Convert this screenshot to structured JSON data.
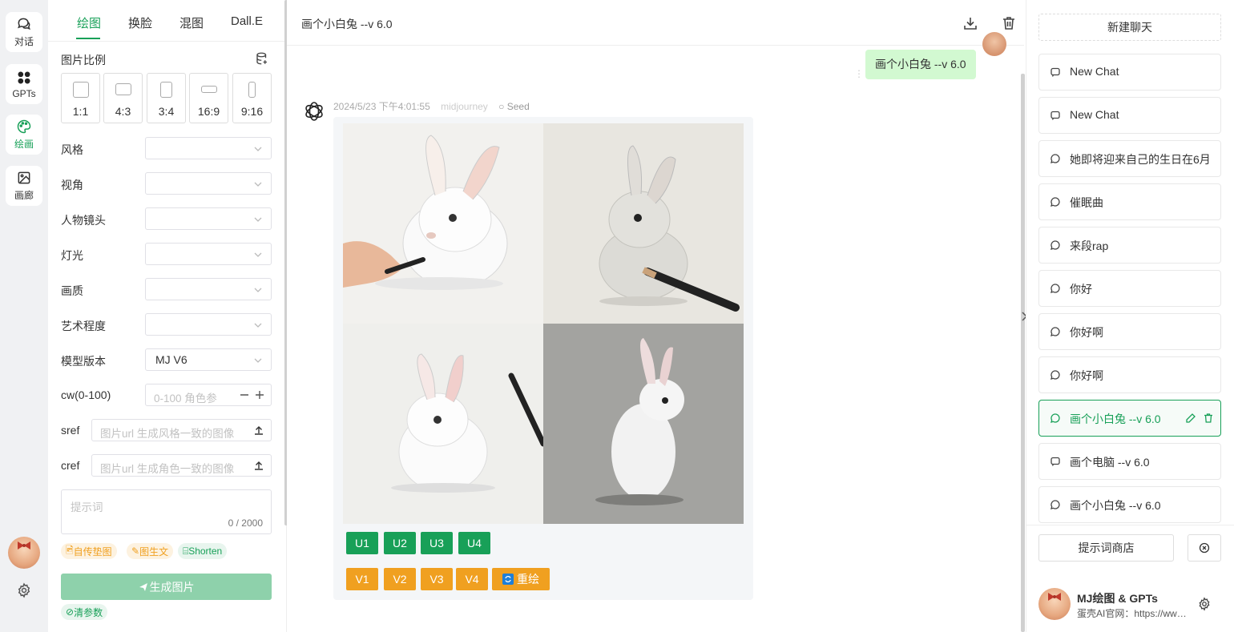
{
  "rail": {
    "items": [
      {
        "label": "对话",
        "icon": "chat-bubbles-icon"
      },
      {
        "label": "GPTs",
        "icon": "apps-grid-icon"
      },
      {
        "label": "绘画",
        "icon": "palette-icon"
      },
      {
        "label": "画廊",
        "icon": "gallery-image-icon"
      }
    ]
  },
  "settings": {
    "tabs": [
      "绘图",
      "换脸",
      "混图",
      "Dall.E"
    ],
    "active_tab": "绘图",
    "ratio_title": "图片比例",
    "ratios": [
      "1:1",
      "4:3",
      "3:4",
      "16:9",
      "9:16"
    ],
    "fields": {
      "style": "风格",
      "angle": "视角",
      "shot": "人物镜头",
      "light": "灯光",
      "quality": "画质",
      "art": "艺术程度",
      "model": "模型版本",
      "model_value": "MJ V6",
      "cw": "cw(0-100)",
      "cw_placeholder": "0-100 角色参",
      "sref": "sref",
      "sref_placeholder": "图片url 生成风格一致的图像",
      "cref": "cref",
      "cref_placeholder": "图片url 生成角色一致的图像"
    },
    "prompt_placeholder": "提示词",
    "prompt_count": "0 / 2000",
    "tags": {
      "upload": "自传垫图",
      "img2txt": "图生文",
      "shorten": "Shorten"
    },
    "generate_label": "生成图片",
    "clear_params": "清参数"
  },
  "chat": {
    "title": "画个小白兔 --v 6.0",
    "user_message": "画个小白兔 --v 6.0",
    "meta": {
      "time": "2024/5/23 下午4:01:55",
      "model": "midjourney",
      "seed": "Seed"
    },
    "u_buttons": [
      "U1",
      "U2",
      "U3",
      "U4"
    ],
    "v_buttons": [
      "V1",
      "V2",
      "V3",
      "V4"
    ],
    "redraw_label": "重绘"
  },
  "sidebar": {
    "new_chat": "新建聊天",
    "history": [
      {
        "title": "New Chat",
        "icon": "message-square-icon"
      },
      {
        "title": "New Chat",
        "icon": "message-square-icon"
      },
      {
        "title": "她即将迎来自己的生日在6月",
        "icon": "message-circle-icon"
      },
      {
        "title": "催眠曲",
        "icon": "message-circle-icon"
      },
      {
        "title": "来段rap",
        "icon": "message-circle-icon"
      },
      {
        "title": "你好",
        "icon": "message-circle-icon"
      },
      {
        "title": "你好啊",
        "icon": "message-circle-icon"
      },
      {
        "title": "你好啊",
        "icon": "message-circle-icon"
      },
      {
        "title": "画个小白兔 --v 6.0",
        "icon": "message-circle-icon",
        "active": true
      },
      {
        "title": "画个电脑 --v 6.0",
        "icon": "message-square-icon"
      },
      {
        "title": "画个小白兔 --v 6.0",
        "icon": "message-circle-icon"
      }
    ],
    "prompt_shop": "提示词商店",
    "profile_name": "MJ绘图 & GPTs",
    "profile_sub": "蛋壳AI官网：https://www.example.com"
  },
  "colors": {
    "accent": "#18a058",
    "warning": "#f0a020",
    "user_bubble": "#d2f9d1"
  }
}
